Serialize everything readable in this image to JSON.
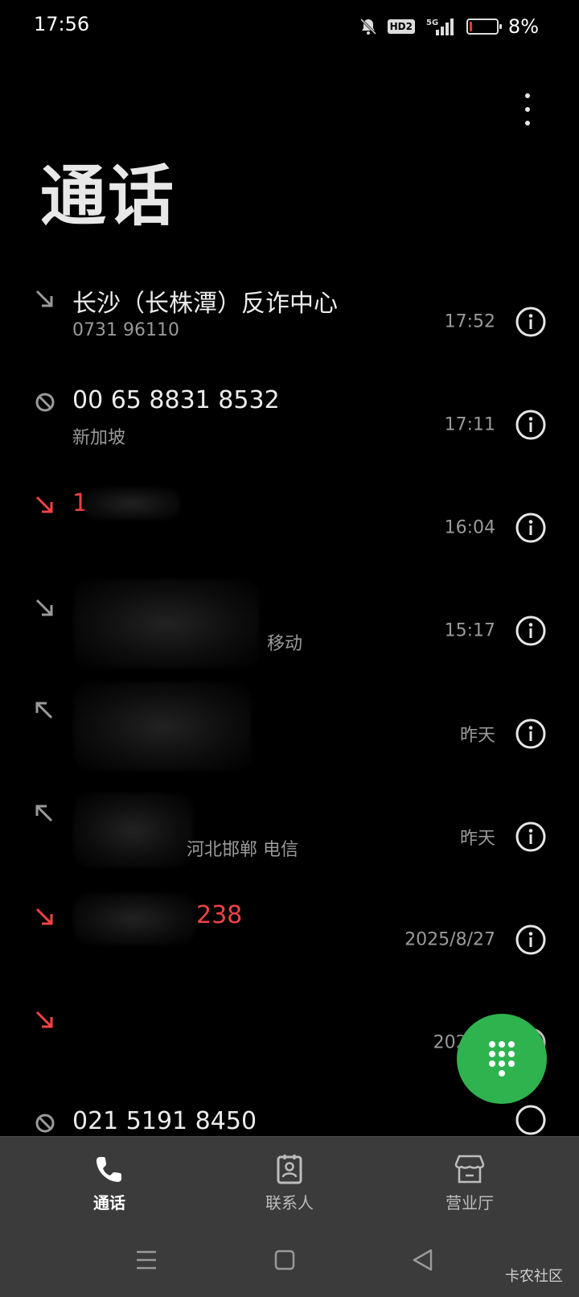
{
  "status_bar": {
    "time": "17:56",
    "icons": [
      "bell-muted-icon",
      "hd-voice-icon",
      "signal-5g-icon",
      "battery-icon"
    ],
    "hd_label": "HD2",
    "network_label": "5G",
    "battery_level": 0.08,
    "battery_percent": "8%"
  },
  "header": {
    "title": "通话",
    "more_icon": "more-vertical-icon"
  },
  "calls": [
    {
      "type": "incoming",
      "name": "长沙（长株潭）反诈中心",
      "sub": "0731 96110",
      "time": "17:52"
    },
    {
      "type": "blocked",
      "name": "00 65 8831 8532",
      "sub": "新加坡",
      "time": "17:11"
    },
    {
      "type": "missed",
      "name": "1",
      "sub": "",
      "time": "16:04"
    },
    {
      "type": "incoming",
      "name": "",
      "sub": "移动",
      "time": "15:17"
    },
    {
      "type": "outgoing",
      "name": "",
      "sub": "",
      "time": "昨天"
    },
    {
      "type": "outgoing",
      "name": "",
      "sub": "河北邯郸 电信",
      "time": "昨天"
    },
    {
      "type": "missed",
      "name": "238",
      "sub": "",
      "time": "2025/8/27"
    },
    {
      "type": "missed",
      "name": "",
      "sub": "",
      "time": "2025/8"
    },
    {
      "type": "blocked",
      "name": "021 5191 8450",
      "sub": "",
      "time": ""
    }
  ],
  "fab": {
    "icon": "dialpad-icon"
  },
  "bottom_nav": [
    {
      "label": "通话",
      "icon": "phone-icon",
      "active": true
    },
    {
      "label": "联系人",
      "icon": "contacts-icon",
      "active": false
    },
    {
      "label": "营业厅",
      "icon": "store-icon",
      "active": false
    }
  ],
  "system_nav": {
    "icons": [
      "menu-lines-icon",
      "home-square-icon",
      "back-triangle-icon"
    ],
    "watermark": "卡农社区"
  },
  "colors": {
    "background": "#000000",
    "missed_red": "#f04343",
    "fab_green": "#2eb34f",
    "nav_bg": "#3b3b3b"
  }
}
